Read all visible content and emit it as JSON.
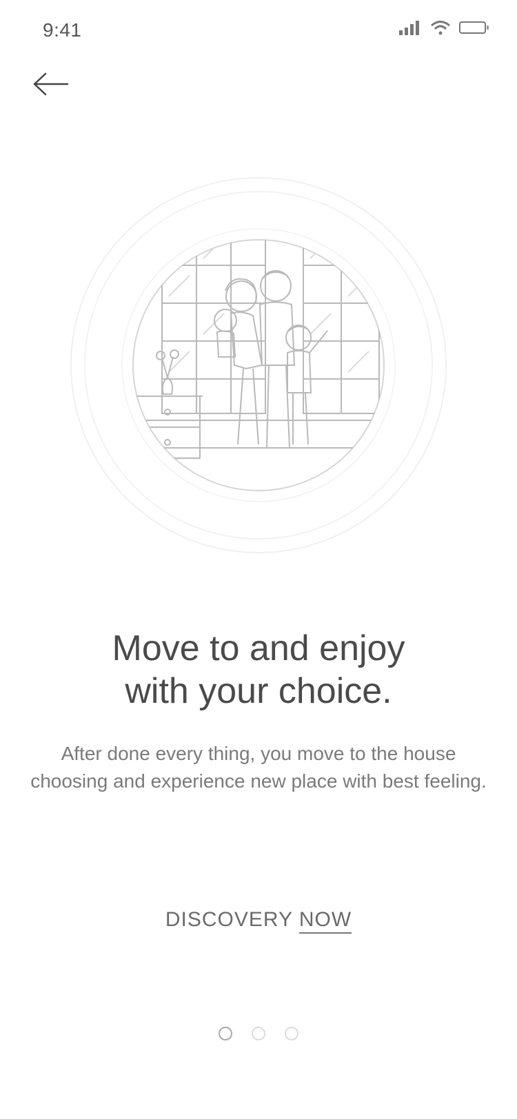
{
  "status_bar": {
    "time": "9:41",
    "icons": [
      "cellular-signal-icon",
      "wifi-icon",
      "battery-icon"
    ]
  },
  "nav": {
    "back_icon": "arrow-left-icon"
  },
  "illustration": {
    "icon": "family-at-home-illustration"
  },
  "onboarding": {
    "title": "Move to and enjoy\nwith your choice.",
    "description": "After done every thing, you move to the house choosing and experience new place with best feeling.",
    "cta_part1": "DISCOVERY ",
    "cta_part2": "NOW"
  },
  "pager": {
    "count": 3,
    "active_index": 0
  },
  "colors": {
    "text_primary": "#4a4a4a",
    "text_secondary": "#7a7a7a",
    "line_art": "#b5b5b5",
    "ring": "#eeeeee"
  }
}
